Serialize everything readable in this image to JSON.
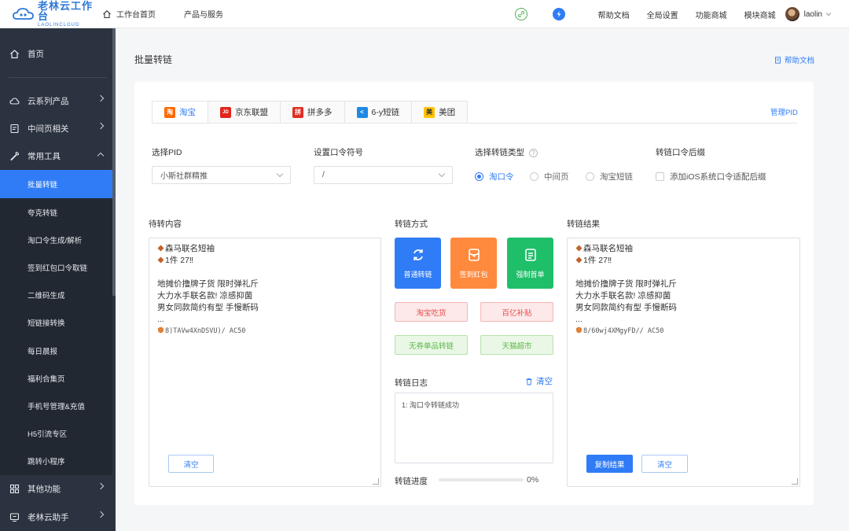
{
  "header": {
    "logo_cn": "老林云工作台",
    "logo_en": "LAOLINCLOUD",
    "nav": [
      {
        "label": "工作台首页",
        "icon": "home-icon"
      },
      {
        "label": "产品与服务"
      }
    ],
    "links": [
      "帮助文档",
      "全局设置",
      "功能商城",
      "模块商城"
    ],
    "username": "laolin",
    "colors": {
      "accent": "#2f7cf6",
      "link_icon": "#4caf50",
      "bolt_icon": "#2f7cf6"
    }
  },
  "sidebar": {
    "home": "首页",
    "groups": [
      {
        "label": "云系列产品",
        "icon": "cloud-icon"
      },
      {
        "label": "中间页相关",
        "icon": "page-icon"
      },
      {
        "label": "常用工具",
        "icon": "tool-icon"
      }
    ],
    "sub_items": [
      "批量转链",
      "夸克转链",
      "淘口令生成/解析",
      "签到红包口令取链",
      "二维码生成",
      "短链接转换",
      "每日晨报",
      "福利合集页",
      "手机号管理&充值",
      "H5引流专区",
      "跳转小程序"
    ],
    "bottom": [
      {
        "label": "其他功能",
        "icon": "grid-icon"
      },
      {
        "label": "老林云助手",
        "icon": "assistant-icon"
      }
    ]
  },
  "main": {
    "title": "批量转链",
    "help_link": "帮助文档",
    "tabs": [
      {
        "label": "淘宝",
        "icon": "taobao-icon",
        "badge": "淘",
        "color": "#ff6a00"
      },
      {
        "label": "京东联盟",
        "icon": "jd-icon",
        "badge": "JD",
        "color": "#e1251b"
      },
      {
        "label": "拼多多",
        "icon": "pinduoduo-icon",
        "badge": "拼",
        "color": "#e02e24"
      },
      {
        "label": "6-y短链",
        "icon": "share-icon",
        "badge": "<",
        "color": "#1e88e5"
      },
      {
        "label": "美团",
        "icon": "meituan-icon",
        "badge": "美",
        "color": "#ffc300"
      }
    ],
    "manage_pid": "管理PID",
    "form": {
      "pid_label": "选择PID",
      "pid_value": "小斯社群精推",
      "symbol_label": "设置口令符号",
      "symbol_value": "/",
      "type_label": "选择转链类型",
      "type_options": [
        "淘口令",
        "中间页",
        "淘宝短链"
      ],
      "type_selected": 0,
      "suffix_label": "转链口令后缀",
      "suffix_option": "添加iOS系统口令适配后缀",
      "suffix_checked": false
    },
    "input": {
      "label": "待转内容",
      "lines": [
        "森马联名短袖",
        "1件 27‼",
        "",
        "地摊价撸牌子货 限时弹礼斤",
        "大力水手联名款! 凉感抑菌",
        "男女同款简约有型 手慢断码",
        "...",
        "8)TAVw4XnDSVU)/ AC50"
      ],
      "clear": "清空"
    },
    "methods": {
      "label": "转链方式",
      "big_buttons": [
        {
          "label": "普通转链",
          "icon": "refresh-icon",
          "color": "#2f7cf6"
        },
        {
          "label": "签到红包",
          "icon": "redpacket-icon",
          "color": "#ff8a3d"
        },
        {
          "label": "强制首单",
          "icon": "list-icon",
          "color": "#1fbf6a"
        }
      ],
      "pills": [
        {
          "label": "淘宝吃货",
          "tone": "red"
        },
        {
          "label": "百亿补贴",
          "tone": "red"
        },
        {
          "label": "无券单品转链",
          "tone": "green"
        },
        {
          "label": "天猫超市",
          "tone": "green"
        }
      ]
    },
    "log": {
      "label": "转链日志",
      "clear": "清空",
      "entries": [
        "1: 淘口令转链成功"
      ]
    },
    "progress": {
      "label": "转链进度",
      "value": 0,
      "text": "0%"
    },
    "output": {
      "label": "转链结果",
      "lines": [
        "森马联名短袖",
        "1件 27‼",
        "",
        "地摊价撸牌子货 限时弹礼斤",
        "大力水手联名款! 凉感抑菌",
        "男女同款简约有型 手慢断码",
        "...",
        "8/60wj4XMgyFD// AC50"
      ],
      "copy": "复制结果",
      "clear": "清空"
    }
  }
}
